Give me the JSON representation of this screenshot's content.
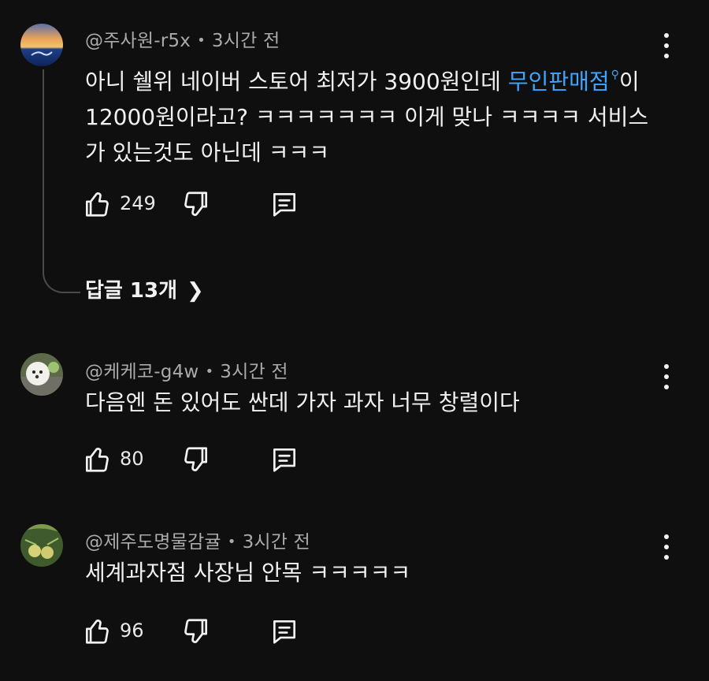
{
  "comments": [
    {
      "author": "@주사원-r5x",
      "time": "3시간 전",
      "text_before": "아니 쉘위 네이버 스토어 최저가 3900원인데 ",
      "link": "무인판매점",
      "text_after": "이 12000원이라고? ㅋㅋㅋㅋㅋㅋㅋ 이게 맞나 ㅋㅋㅋㅋ 서비스가 있는것도 아닌데 ㅋㅋㅋ",
      "likes": "249",
      "replies_label": "답글 13개"
    },
    {
      "author": "@케케코-g4w",
      "time": "3시간 전",
      "text": "다음엔 돈 있어도 싼데 가자 과자 너무 창렬이다",
      "likes": "80"
    },
    {
      "author": "@제주도명물감귤",
      "time": "3시간 전",
      "text": "세계과자점 사장님 안목 ㅋㅋㅋㅋㅋ",
      "likes": "96"
    }
  ],
  "icons": {
    "like": "thumbs-up-icon",
    "dislike": "thumbs-down-icon",
    "reply": "comment-icon",
    "more": "more-vert-icon",
    "chevron": "chevron-right-icon",
    "link": "search-icon"
  },
  "colors": {
    "background": "#0f0f0f",
    "text": "#f1f1f1",
    "meta": "#aaaaaa",
    "link": "#3ea6ff"
  }
}
